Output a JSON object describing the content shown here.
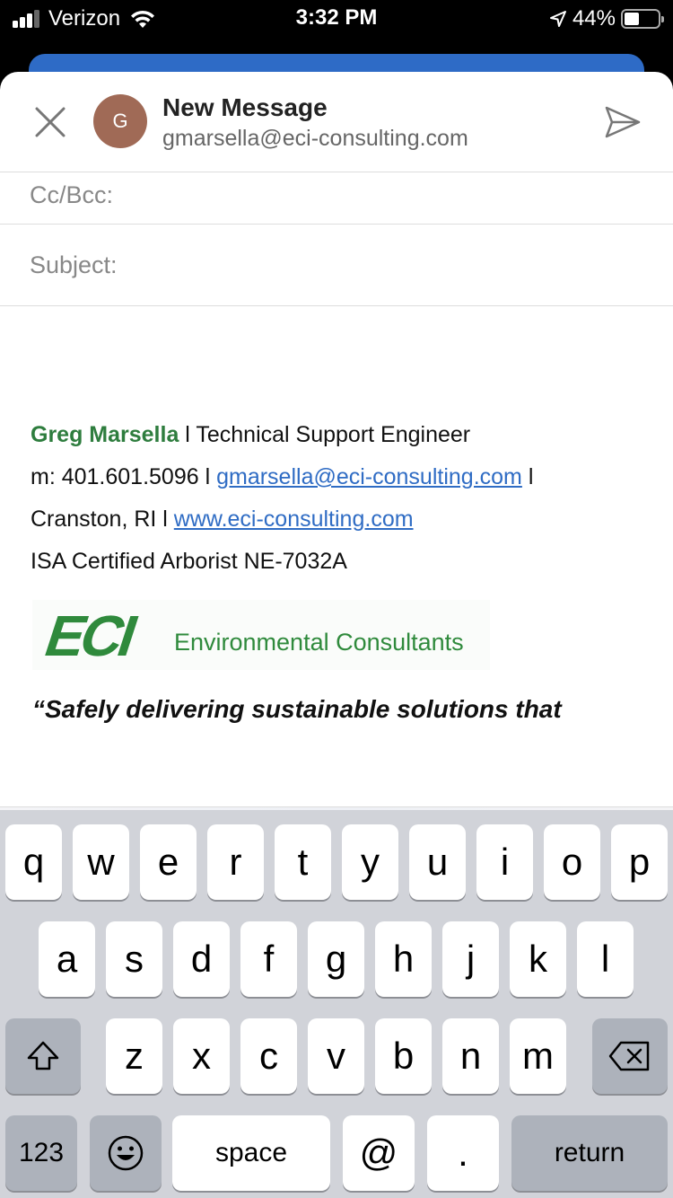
{
  "status_bar": {
    "carrier": "Verizon",
    "time": "3:32 PM",
    "battery_percent": "44%",
    "battery_level": 0.44,
    "icons": [
      "signal-icon",
      "wifi-icon",
      "location-arrow-icon",
      "battery-icon"
    ]
  },
  "header": {
    "avatar_initial": "G",
    "title": "New Message",
    "from_account": "gmarsella@eci-consulting.com"
  },
  "fields": {
    "cc_bcc_label": "Cc/Bcc:",
    "subject_label": "Subject:"
  },
  "signature": {
    "name": "Greg Marsella",
    "title_sep": " l ",
    "title": "Technical Support Engineer",
    "mobile": "m: 401.601.5096 l ",
    "email": "gmarsella@eci-consulting.com",
    "email_sep": " l",
    "location": "Cranston, RI l ",
    "website": "www.eci-consulting.com",
    "certification": "ISA Certified Arborist NE-7032A",
    "logo_mark": "ECI",
    "logo_text": "Environmental Consultants",
    "tagline": "“Safely delivering sustainable solutions that"
  },
  "toolbar": {
    "icons": [
      "calendar-add-icon",
      "attachment-icon",
      "camera-icon",
      "text-format-icon"
    ]
  },
  "keyboard": {
    "row1": [
      "q",
      "w",
      "e",
      "r",
      "t",
      "y",
      "u",
      "i",
      "o",
      "p"
    ],
    "row2": [
      "a",
      "s",
      "d",
      "f",
      "g",
      "h",
      "j",
      "k",
      "l"
    ],
    "row3": [
      "z",
      "x",
      "c",
      "v",
      "b",
      "n",
      "m"
    ],
    "numbers_key": "123",
    "space_key": "space",
    "at_key": "@",
    "period_key": ".",
    "return_key": "return"
  },
  "colors": {
    "accent_blue": "#2e6bc6",
    "link_blue": "#2f6cc4",
    "signature_green": "#2e7d3e",
    "avatar_brown": "#a06a56",
    "logo_green": "#2f8a3c"
  }
}
